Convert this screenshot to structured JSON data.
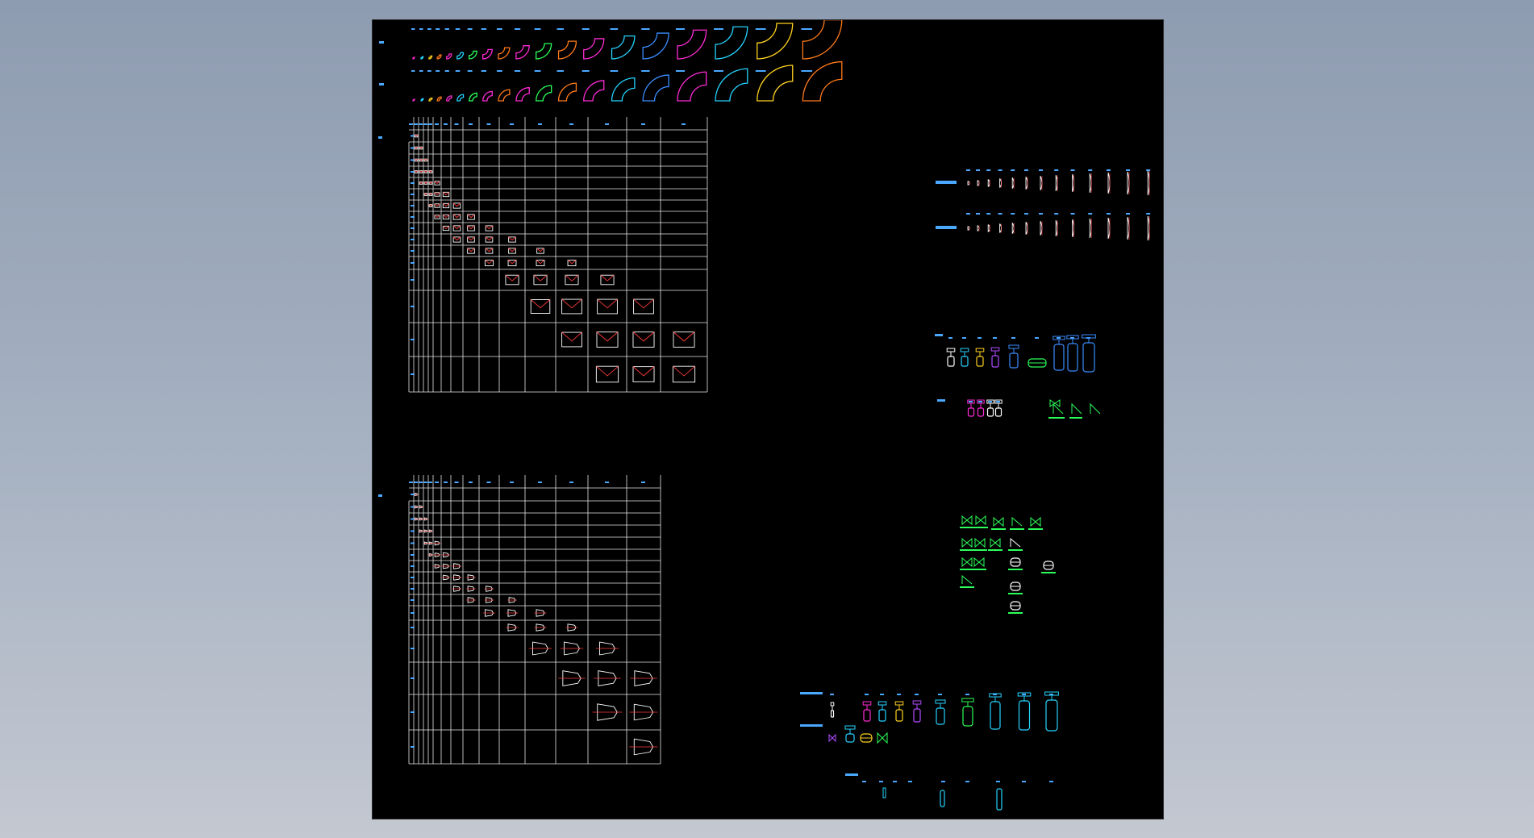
{
  "app": {
    "title": "",
    "mode": "model-space",
    "background_color": "#000000",
    "desktop_gradient": [
      "#8e9cb1",
      "#c3c8d1"
    ]
  },
  "colors": {
    "grid": "#e6e6e6",
    "label": "#4aa8ff",
    "part_outline": "#ffffff",
    "part_accent": "#ff3b3b",
    "magenta": "#ff2bd6",
    "cyan": "#25d3ff",
    "green": "#2bff5a",
    "yellow": "#ffd21f",
    "purple": "#b04bff",
    "orange": "#ff7a1a",
    "blue": "#3a8dff"
  },
  "drawing": {
    "elbow_rows": [
      {
        "label": "",
        "count": 19,
        "color_names": [
          "magenta",
          "cyan",
          "yellow",
          "orange",
          "magenta",
          "cyan",
          "green",
          "magenta",
          "orange",
          "magenta",
          "green",
          "orange",
          "magenta",
          "cyan",
          "blue"
        ]
      },
      {
        "label": "",
        "count": 19,
        "color_names": [
          "magenta",
          "cyan",
          "yellow",
          "orange",
          "magenta",
          "cyan",
          "green",
          "magenta",
          "orange",
          "magenta",
          "green",
          "orange",
          "magenta",
          "cyan",
          "blue"
        ]
      }
    ],
    "tee_table": {
      "label": "",
      "sizes": 20,
      "symbol": "tee"
    },
    "reducer_table": {
      "label": "",
      "sizes": 17,
      "symbol": "reducer"
    },
    "cap_rows": [
      {
        "label": "",
        "count": 13
      },
      {
        "label": "",
        "count": 13
      }
    ],
    "valve_group_1": {
      "label": "",
      "icon_names": [
        "gate-valve-icon",
        "globe-valve-icon",
        "check-valve-icon",
        "ball-valve-icon",
        "butterfly-valve-icon",
        "strainer-icon",
        "control-valve-icon",
        "control-valve-icon",
        "control-valve-icon"
      ]
    },
    "valve_group_2": {
      "label": "",
      "icon_names": [
        "flange-valve-icon",
        "flange-valve-icon",
        "flange-valve-icon",
        "flange-valve-icon",
        "angle-valve-icon",
        "angle-valve-icon",
        "angle-valve-icon"
      ]
    },
    "symbol_cluster": {
      "label": ""
    },
    "bottom_valves": {
      "row_labels": [
        "",
        ""
      ]
    },
    "bottom_misc": {
      "label": ""
    }
  }
}
